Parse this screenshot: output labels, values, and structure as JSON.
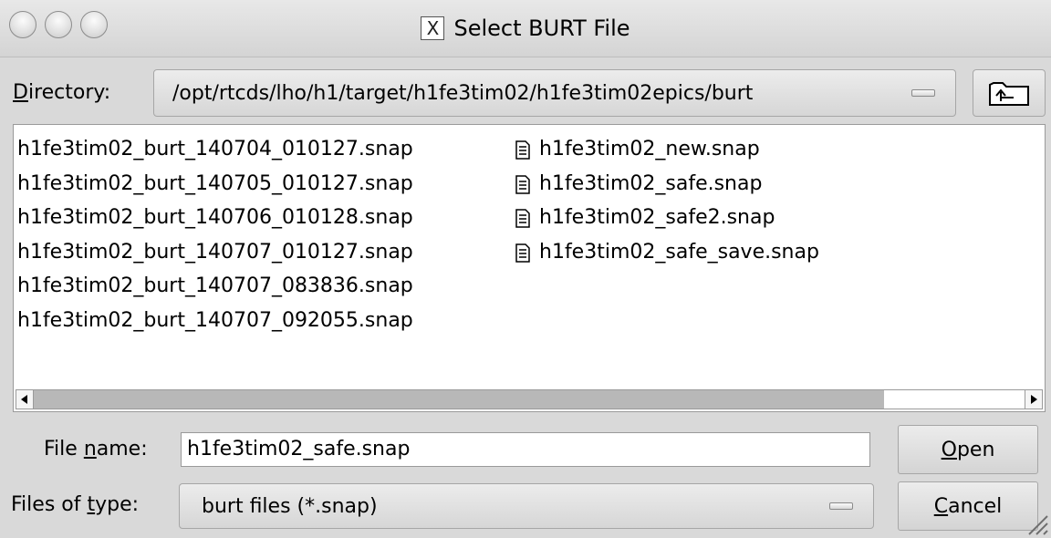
{
  "window": {
    "title": "Select BURT File",
    "title_icon_glyph": "X",
    "controls": [
      "close-button",
      "minimize-button",
      "maximize-button"
    ]
  },
  "directory": {
    "label_accel": "D",
    "label_rest": "irectory:",
    "value": "/opt/rtcds/lho/h1/target/h1fe3tim02/h1fe3tim02epics/burt",
    "up_icon": "folder-up-icon"
  },
  "files_col1": [
    "h1fe3tim02_burt_140704_010127.snap",
    "h1fe3tim02_burt_140705_010127.snap",
    "h1fe3tim02_burt_140706_010128.snap",
    "h1fe3tim02_burt_140707_010127.snap",
    "h1fe3tim02_burt_140707_083836.snap",
    "h1fe3tim02_burt_140707_092055.snap"
  ],
  "files_col2": [
    "h1fe3tim02_new.snap",
    "h1fe3tim02_safe.snap",
    "h1fe3tim02_safe2.snap",
    "h1fe3tim02_safe_save.snap"
  ],
  "file_name": {
    "label_pre": "File ",
    "label_accel": "n",
    "label_post": "ame:",
    "value": "h1fe3tim02_safe.snap"
  },
  "file_type": {
    "label_pre": "Files of ",
    "label_accel": "t",
    "label_post": "ype:",
    "value": "burt files (*.snap)"
  },
  "buttons": {
    "open_accel": "O",
    "open_rest": "pen",
    "cancel_accel": "C",
    "cancel_rest": "ancel"
  },
  "colors": {
    "background": "#d9d9d9",
    "list_background": "#ffffff",
    "scroll_track": "#b8b8b8"
  }
}
